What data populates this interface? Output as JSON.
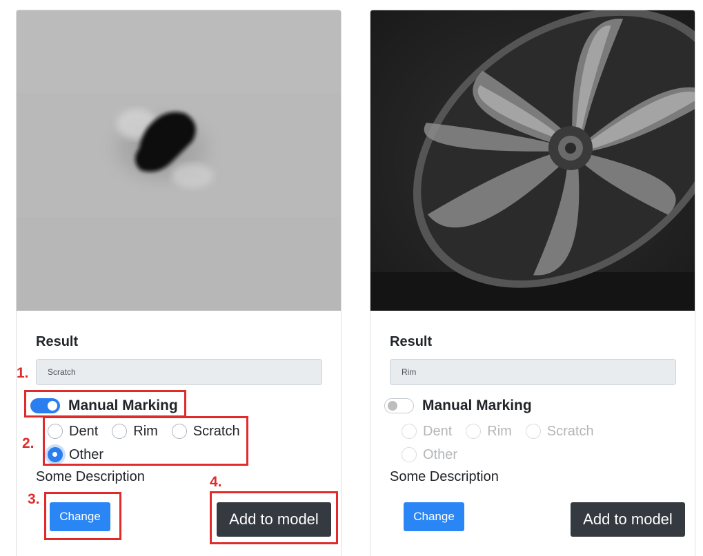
{
  "cards": [
    {
      "result_title": "Result",
      "result_value": "Scratch",
      "toggle_label": "Manual Marking",
      "toggle_on": true,
      "options": [
        "Dent",
        "Rim",
        "Scratch",
        "Other"
      ],
      "selected": "Other",
      "description": "Some Description",
      "change_label": "Change",
      "add_label": "Add to model"
    },
    {
      "result_title": "Result",
      "result_value": "Rim",
      "toggle_label": "Manual Marking",
      "toggle_on": false,
      "options": [
        "Dent",
        "Rim",
        "Scratch",
        "Other"
      ],
      "selected": null,
      "description": "Some Description",
      "change_label": "Change",
      "add_label": "Add to model"
    }
  ],
  "annotations": [
    "1.",
    "2.",
    "3.",
    "4."
  ],
  "colors": {
    "accent": "#2a86f5",
    "dark_button": "#343a40",
    "annotation": "#e02b2b",
    "field_bg": "#e9ecef"
  }
}
